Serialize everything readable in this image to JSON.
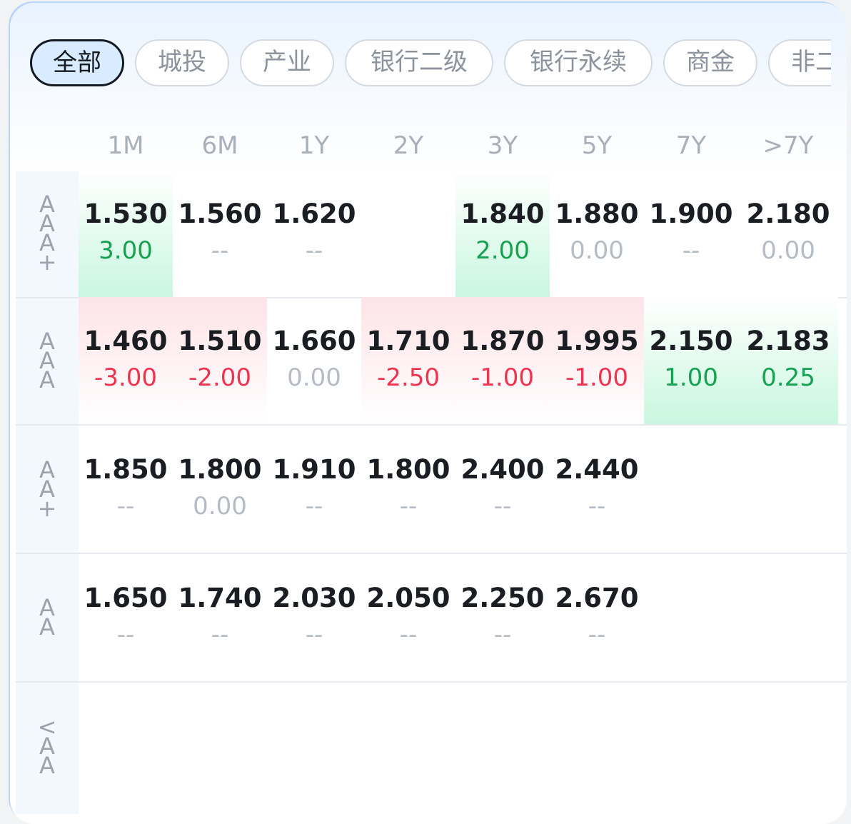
{
  "tabs": [
    "全部",
    "城投",
    "产业",
    "银行二级",
    "银行永续",
    "商金",
    "非二"
  ],
  "active_tab": 0,
  "columns": [
    "1M",
    "6M",
    "1Y",
    "2Y",
    "3Y",
    "5Y",
    "7Y",
    ">7Y"
  ],
  "rows": [
    {
      "label": [
        "A",
        "A",
        "A",
        "+"
      ],
      "cells": [
        {
          "yield": "1.530",
          "change": "3.00",
          "trend": "pos"
        },
        {
          "yield": "1.560",
          "change": "--",
          "trend": "none"
        },
        {
          "yield": "1.620",
          "change": "--",
          "trend": "none"
        },
        {
          "yield": "",
          "change": "",
          "trend": "none"
        },
        {
          "yield": "1.840",
          "change": "2.00",
          "trend": "pos"
        },
        {
          "yield": "1.880",
          "change": "0.00",
          "trend": "none"
        },
        {
          "yield": "1.900",
          "change": "--",
          "trend": "none"
        },
        {
          "yield": "2.180",
          "change": "0.00",
          "trend": "none"
        }
      ]
    },
    {
      "label": [
        "A",
        "A",
        "A"
      ],
      "cells": [
        {
          "yield": "1.460",
          "change": "-3.00",
          "trend": "neg"
        },
        {
          "yield": "1.510",
          "change": "-2.00",
          "trend": "neg"
        },
        {
          "yield": "1.660",
          "change": "0.00",
          "trend": "none"
        },
        {
          "yield": "1.710",
          "change": "-2.50",
          "trend": "neg"
        },
        {
          "yield": "1.870",
          "change": "-1.00",
          "trend": "neg"
        },
        {
          "yield": "1.995",
          "change": "-1.00",
          "trend": "neg"
        },
        {
          "yield": "2.150",
          "change": "1.00",
          "trend": "pos"
        },
        {
          "yield": "2.183",
          "change": "0.25",
          "trend": "pos"
        }
      ]
    },
    {
      "label": [
        "A",
        "A",
        "+"
      ],
      "cells": [
        {
          "yield": "1.850",
          "change": "--",
          "trend": "none"
        },
        {
          "yield": "1.800",
          "change": "0.00",
          "trend": "none"
        },
        {
          "yield": "1.910",
          "change": "--",
          "trend": "none"
        },
        {
          "yield": "1.800",
          "change": "--",
          "trend": "none"
        },
        {
          "yield": "2.400",
          "change": "--",
          "trend": "none"
        },
        {
          "yield": "2.440",
          "change": "--",
          "trend": "none"
        },
        {
          "yield": "",
          "change": "",
          "trend": "none"
        },
        {
          "yield": "",
          "change": "",
          "trend": "none"
        }
      ]
    },
    {
      "label": [
        "A",
        "A"
      ],
      "cells": [
        {
          "yield": "1.650",
          "change": "--",
          "trend": "none"
        },
        {
          "yield": "1.740",
          "change": "--",
          "trend": "none"
        },
        {
          "yield": "2.030",
          "change": "--",
          "trend": "none"
        },
        {
          "yield": "2.050",
          "change": "--",
          "trend": "none"
        },
        {
          "yield": "2.250",
          "change": "--",
          "trend": "none"
        },
        {
          "yield": "2.670",
          "change": "--",
          "trend": "none"
        },
        {
          "yield": "",
          "change": "",
          "trend": "none"
        },
        {
          "yield": "",
          "change": "",
          "trend": "none"
        }
      ]
    },
    {
      "label": [
        "<",
        "A",
        "A"
      ],
      "cells": []
    }
  ],
  "colors": {
    "positive": "#17a152",
    "negative": "#ef3450",
    "neutral": "#b6bcc6",
    "active_tab_bg": "#d9ebff"
  }
}
